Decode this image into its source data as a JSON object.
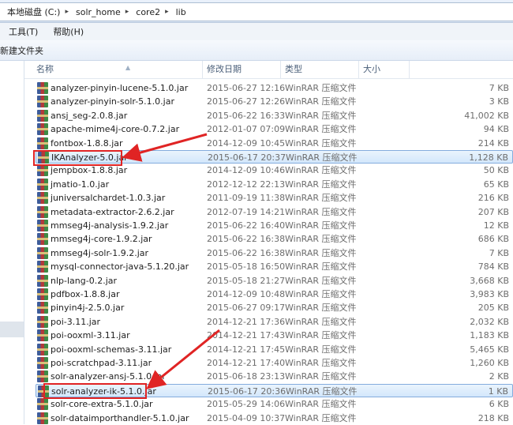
{
  "address": {
    "crumbs": [
      "本地磁盘 (C:)",
      "solr_home",
      "core2",
      "lib"
    ],
    "separator": "▸"
  },
  "menu": {
    "tools": "工具(T)",
    "help": "帮助(H)"
  },
  "toolbar": {
    "new_folder": "新建文件夹"
  },
  "columns": {
    "name": "名称",
    "date": "修改日期",
    "type": "类型",
    "size": "大小"
  },
  "colors": {
    "highlight_box": "#e02424",
    "selected_row": "#d3e7fb"
  },
  "files": [
    {
      "name": "analyzer-pinyin-lucene-5.1.0.jar",
      "date": "2015-06-27 12:16",
      "type": "WinRAR 压缩文件",
      "size": "7 KB"
    },
    {
      "name": "analyzer-pinyin-solr-5.1.0.jar",
      "date": "2015-06-27 12:26",
      "type": "WinRAR 压缩文件",
      "size": "3 KB"
    },
    {
      "name": "ansj_seg-2.0.8.jar",
      "date": "2015-06-22 16:33",
      "type": "WinRAR 压缩文件",
      "size": "41,002 KB"
    },
    {
      "name": "apache-mime4j-core-0.7.2.jar",
      "date": "2012-01-07 07:09",
      "type": "WinRAR 压缩文件",
      "size": "94 KB"
    },
    {
      "name": "fontbox-1.8.8.jar",
      "date": "2014-12-09 10:45",
      "type": "WinRAR 压缩文件",
      "size": "214 KB"
    },
    {
      "name": "IKAnalyzer-5.0.jar",
      "date": "2015-06-17 20:37",
      "type": "WinRAR 压缩文件",
      "size": "1,128 KB",
      "selected": true
    },
    {
      "name": "jempbox-1.8.8.jar",
      "date": "2014-12-09 10:46",
      "type": "WinRAR 压缩文件",
      "size": "50 KB"
    },
    {
      "name": "jmatio-1.0.jar",
      "date": "2012-12-12 22:13",
      "type": "WinRAR 压缩文件",
      "size": "65 KB"
    },
    {
      "name": "juniversalchardet-1.0.3.jar",
      "date": "2011-09-19 11:38",
      "type": "WinRAR 压缩文件",
      "size": "216 KB"
    },
    {
      "name": "metadata-extractor-2.6.2.jar",
      "date": "2012-07-19 14:21",
      "type": "WinRAR 压缩文件",
      "size": "207 KB"
    },
    {
      "name": "mmseg4j-analysis-1.9.2.jar",
      "date": "2015-06-22 16:40",
      "type": "WinRAR 压缩文件",
      "size": "12 KB"
    },
    {
      "name": "mmseg4j-core-1.9.2.jar",
      "date": "2015-06-22 16:38",
      "type": "WinRAR 压缩文件",
      "size": "686 KB"
    },
    {
      "name": "mmseg4j-solr-1.9.2.jar",
      "date": "2015-06-22 16:38",
      "type": "WinRAR 压缩文件",
      "size": "7 KB"
    },
    {
      "name": "mysql-connector-java-5.1.20.jar",
      "date": "2015-05-18 16:50",
      "type": "WinRAR 压缩文件",
      "size": "784 KB"
    },
    {
      "name": "nlp-lang-0.2.jar",
      "date": "2015-05-18 21:27",
      "type": "WinRAR 压缩文件",
      "size": "3,668 KB"
    },
    {
      "name": "pdfbox-1.8.8.jar",
      "date": "2014-12-09 10:48",
      "type": "WinRAR 压缩文件",
      "size": "3,983 KB"
    },
    {
      "name": "pinyin4j-2.5.0.jar",
      "date": "2015-06-27 09:17",
      "type": "WinRAR 压缩文件",
      "size": "205 KB"
    },
    {
      "name": "poi-3.11.jar",
      "date": "2014-12-21 17:36",
      "type": "WinRAR 压缩文件",
      "size": "2,032 KB"
    },
    {
      "name": "poi-ooxml-3.11.jar",
      "date": "2014-12-21 17:43",
      "type": "WinRAR 压缩文件",
      "size": "1,183 KB"
    },
    {
      "name": "poi-ooxml-schemas-3.11.jar",
      "date": "2014-12-21 17:45",
      "type": "WinRAR 压缩文件",
      "size": "5,465 KB"
    },
    {
      "name": "poi-scratchpad-3.11.jar",
      "date": "2014-12-21 17:40",
      "type": "WinRAR 压缩文件",
      "size": "1,260 KB"
    },
    {
      "name": "solr-analyzer-ansj-5.1.0.jar",
      "date": "2015-06-18 23:13",
      "type": "WinRAR 压缩文件",
      "size": "2 KB"
    },
    {
      "name": "solr-analyzer-ik-5.1.0.jar",
      "date": "2015-06-17 20:36",
      "type": "WinRAR 压缩文件",
      "size": "1 KB",
      "selected": true
    },
    {
      "name": "solr-core-extra-5.1.0.jar",
      "date": "2015-05-29 14:06",
      "type": "WinRAR 压缩文件",
      "size": "6 KB"
    },
    {
      "name": "solr-dataimporthandler-5.1.0.jar",
      "date": "2015-04-09 10:37",
      "type": "WinRAR 压缩文件",
      "size": "218 KB"
    }
  ]
}
